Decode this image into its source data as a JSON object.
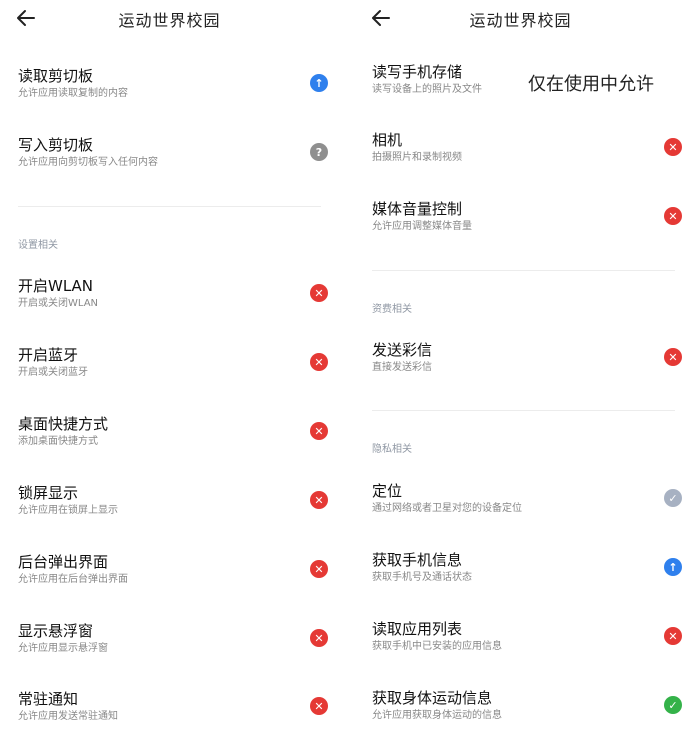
{
  "left": {
    "title": "运动世界校园",
    "items_top": [
      {
        "title": "读取剪切板",
        "desc": "允许应用读取复制的内容",
        "status": "info"
      },
      {
        "title": "写入剪切板",
        "desc": "允许应用向剪切板写入任何内容",
        "status": "ask"
      }
    ],
    "section": "设置相关",
    "items_settings": [
      {
        "title": "开启WLAN",
        "desc": "开启或关闭WLAN",
        "status": "deny"
      },
      {
        "title": "开启蓝牙",
        "desc": "开启或关闭蓝牙",
        "status": "deny"
      },
      {
        "title": "桌面快捷方式",
        "desc": "添加桌面快捷方式",
        "status": "deny"
      },
      {
        "title": "锁屏显示",
        "desc": "允许应用在锁屏上显示",
        "status": "deny"
      },
      {
        "title": "后台弹出界面",
        "desc": "允许应用在后台弹出界面",
        "status": "deny"
      },
      {
        "title": "显示悬浮窗",
        "desc": "允许应用显示悬浮窗",
        "status": "deny"
      },
      {
        "title": "常驻通知",
        "desc": "允许应用发送常驻通知",
        "status": "deny"
      }
    ]
  },
  "right": {
    "title": "运动世界校园",
    "items_top": [
      {
        "title": "读写手机存储",
        "desc": "读写设备上的照片及文件"
      },
      {
        "title": "相机",
        "desc": "拍摄照片和录制视频",
        "status": "deny"
      },
      {
        "title": "媒体音量控制",
        "desc": "允许应用调整媒体音量",
        "status": "deny"
      }
    ],
    "section_fee": "资费相关",
    "items_fee": [
      {
        "title": "发送彩信",
        "desc": "直接发送彩信",
        "status": "deny"
      }
    ],
    "section_privacy": "隐私相关",
    "items_privacy": [
      {
        "title": "定位",
        "desc": "通过网络或者卫星对您的设备定位",
        "status": "pending"
      },
      {
        "title": "获取手机信息",
        "desc": "获取手机号及通话状态",
        "status": "info"
      },
      {
        "title": "读取应用列表",
        "desc": "获取手机中已安装的应用信息",
        "status": "deny"
      },
      {
        "title": "获取身体运动信息",
        "desc": "允许应用获取身体运动的信息",
        "status": "allow"
      }
    ]
  },
  "overlay_note": "仅在使用中允许",
  "colors": {
    "deny": "#e53935",
    "allow": "#34b249",
    "info": "#2f80ed",
    "ask": "#8f8f8f",
    "pending": "#a7b1c2"
  }
}
